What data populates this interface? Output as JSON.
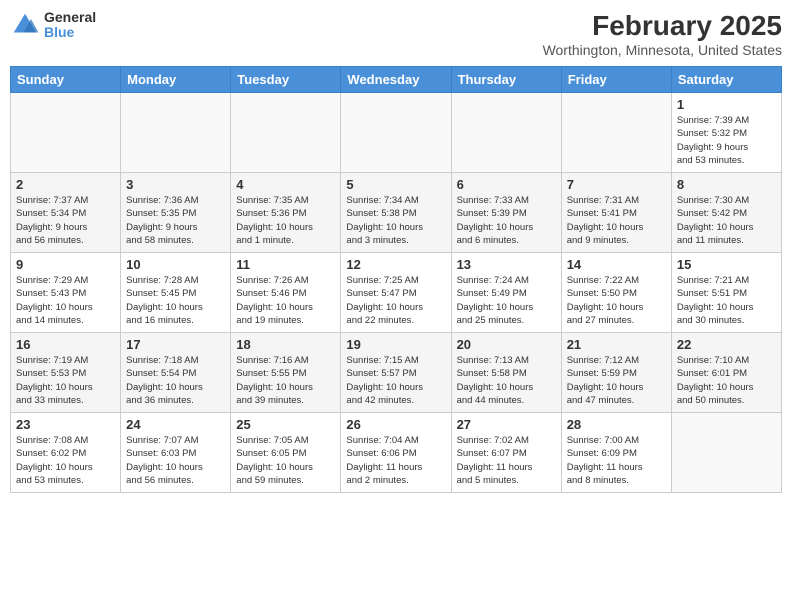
{
  "header": {
    "logo": {
      "general": "General",
      "blue": "Blue"
    },
    "month_year": "February 2025",
    "location": "Worthington, Minnesota, United States"
  },
  "days_of_week": [
    "Sunday",
    "Monday",
    "Tuesday",
    "Wednesday",
    "Thursday",
    "Friday",
    "Saturday"
  ],
  "weeks": [
    [
      {
        "day": "",
        "info": ""
      },
      {
        "day": "",
        "info": ""
      },
      {
        "day": "",
        "info": ""
      },
      {
        "day": "",
        "info": ""
      },
      {
        "day": "",
        "info": ""
      },
      {
        "day": "",
        "info": ""
      },
      {
        "day": "1",
        "info": "Sunrise: 7:39 AM\nSunset: 5:32 PM\nDaylight: 9 hours\nand 53 minutes."
      }
    ],
    [
      {
        "day": "2",
        "info": "Sunrise: 7:37 AM\nSunset: 5:34 PM\nDaylight: 9 hours\nand 56 minutes."
      },
      {
        "day": "3",
        "info": "Sunrise: 7:36 AM\nSunset: 5:35 PM\nDaylight: 9 hours\nand 58 minutes."
      },
      {
        "day": "4",
        "info": "Sunrise: 7:35 AM\nSunset: 5:36 PM\nDaylight: 10 hours\nand 1 minute."
      },
      {
        "day": "5",
        "info": "Sunrise: 7:34 AM\nSunset: 5:38 PM\nDaylight: 10 hours\nand 3 minutes."
      },
      {
        "day": "6",
        "info": "Sunrise: 7:33 AM\nSunset: 5:39 PM\nDaylight: 10 hours\nand 6 minutes."
      },
      {
        "day": "7",
        "info": "Sunrise: 7:31 AM\nSunset: 5:41 PM\nDaylight: 10 hours\nand 9 minutes."
      },
      {
        "day": "8",
        "info": "Sunrise: 7:30 AM\nSunset: 5:42 PM\nDaylight: 10 hours\nand 11 minutes."
      }
    ],
    [
      {
        "day": "9",
        "info": "Sunrise: 7:29 AM\nSunset: 5:43 PM\nDaylight: 10 hours\nand 14 minutes."
      },
      {
        "day": "10",
        "info": "Sunrise: 7:28 AM\nSunset: 5:45 PM\nDaylight: 10 hours\nand 16 minutes."
      },
      {
        "day": "11",
        "info": "Sunrise: 7:26 AM\nSunset: 5:46 PM\nDaylight: 10 hours\nand 19 minutes."
      },
      {
        "day": "12",
        "info": "Sunrise: 7:25 AM\nSunset: 5:47 PM\nDaylight: 10 hours\nand 22 minutes."
      },
      {
        "day": "13",
        "info": "Sunrise: 7:24 AM\nSunset: 5:49 PM\nDaylight: 10 hours\nand 25 minutes."
      },
      {
        "day": "14",
        "info": "Sunrise: 7:22 AM\nSunset: 5:50 PM\nDaylight: 10 hours\nand 27 minutes."
      },
      {
        "day": "15",
        "info": "Sunrise: 7:21 AM\nSunset: 5:51 PM\nDaylight: 10 hours\nand 30 minutes."
      }
    ],
    [
      {
        "day": "16",
        "info": "Sunrise: 7:19 AM\nSunset: 5:53 PM\nDaylight: 10 hours\nand 33 minutes."
      },
      {
        "day": "17",
        "info": "Sunrise: 7:18 AM\nSunset: 5:54 PM\nDaylight: 10 hours\nand 36 minutes."
      },
      {
        "day": "18",
        "info": "Sunrise: 7:16 AM\nSunset: 5:55 PM\nDaylight: 10 hours\nand 39 minutes."
      },
      {
        "day": "19",
        "info": "Sunrise: 7:15 AM\nSunset: 5:57 PM\nDaylight: 10 hours\nand 42 minutes."
      },
      {
        "day": "20",
        "info": "Sunrise: 7:13 AM\nSunset: 5:58 PM\nDaylight: 10 hours\nand 44 minutes."
      },
      {
        "day": "21",
        "info": "Sunrise: 7:12 AM\nSunset: 5:59 PM\nDaylight: 10 hours\nand 47 minutes."
      },
      {
        "day": "22",
        "info": "Sunrise: 7:10 AM\nSunset: 6:01 PM\nDaylight: 10 hours\nand 50 minutes."
      }
    ],
    [
      {
        "day": "23",
        "info": "Sunrise: 7:08 AM\nSunset: 6:02 PM\nDaylight: 10 hours\nand 53 minutes."
      },
      {
        "day": "24",
        "info": "Sunrise: 7:07 AM\nSunset: 6:03 PM\nDaylight: 10 hours\nand 56 minutes."
      },
      {
        "day": "25",
        "info": "Sunrise: 7:05 AM\nSunset: 6:05 PM\nDaylight: 10 hours\nand 59 minutes."
      },
      {
        "day": "26",
        "info": "Sunrise: 7:04 AM\nSunset: 6:06 PM\nDaylight: 11 hours\nand 2 minutes."
      },
      {
        "day": "27",
        "info": "Sunrise: 7:02 AM\nSunset: 6:07 PM\nDaylight: 11 hours\nand 5 minutes."
      },
      {
        "day": "28",
        "info": "Sunrise: 7:00 AM\nSunset: 6:09 PM\nDaylight: 11 hours\nand 8 minutes."
      },
      {
        "day": "",
        "info": ""
      }
    ]
  ]
}
